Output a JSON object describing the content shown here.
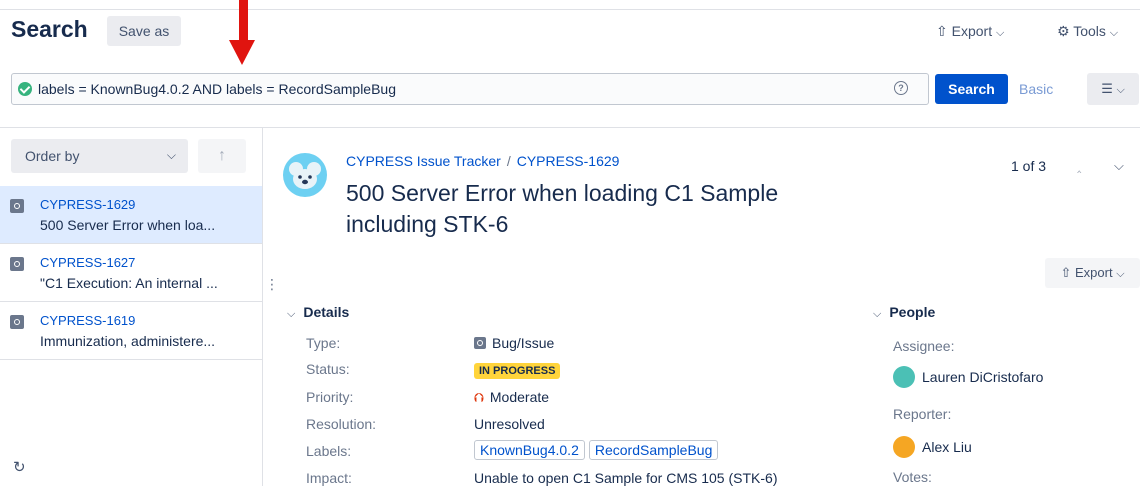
{
  "header": {
    "title": "Search",
    "save_as": "Save as",
    "export": "Export",
    "tools": "Tools"
  },
  "query": {
    "jql": "labels = KnownBug4.0.2 AND labels = RecordSampleBug",
    "search_button": "Search",
    "basic_link": "Basic"
  },
  "sidebar": {
    "order_by": "Order by",
    "items": [
      {
        "key": "CYPRESS-1629",
        "summary": "500 Server Error when loa...",
        "selected": true
      },
      {
        "key": "CYPRESS-1627",
        "summary": "\"C1 Execution: An internal ...",
        "selected": false
      },
      {
        "key": "CYPRESS-1619",
        "summary": "Immunization, administere...",
        "selected": false
      }
    ]
  },
  "issue": {
    "project": "CYPRESS Issue Tracker",
    "key": "CYPRESS-1629",
    "title": "500 Server Error when loading C1 Sample including STK-6",
    "pager": "1 of 3",
    "export": "Export",
    "details_heading": "Details",
    "details": {
      "type_label": "Type:",
      "type_value": "Bug/Issue",
      "status_label": "Status:",
      "status_value": "IN PROGRESS",
      "priority_label": "Priority:",
      "priority_value": "Moderate",
      "resolution_label": "Resolution:",
      "resolution_value": "Unresolved",
      "labels_label": "Labels:",
      "labels": [
        "KnownBug4.0.2",
        "RecordSampleBug"
      ],
      "impact_label": "Impact:",
      "impact_value": "Unable to open C1 Sample for CMS 105 (STK-6)"
    },
    "people_heading": "People",
    "people": {
      "assignee_label": "Assignee:",
      "assignee": "Lauren DiCristofaro",
      "reporter_label": "Reporter:",
      "reporter": "Alex Liu",
      "votes_label": "Votes:"
    }
  },
  "colors": {
    "primary": "#0052cc",
    "status_in_progress": "#ffd43b",
    "selected_row": "#deebff",
    "annotation_arrow": "#e0140f"
  }
}
